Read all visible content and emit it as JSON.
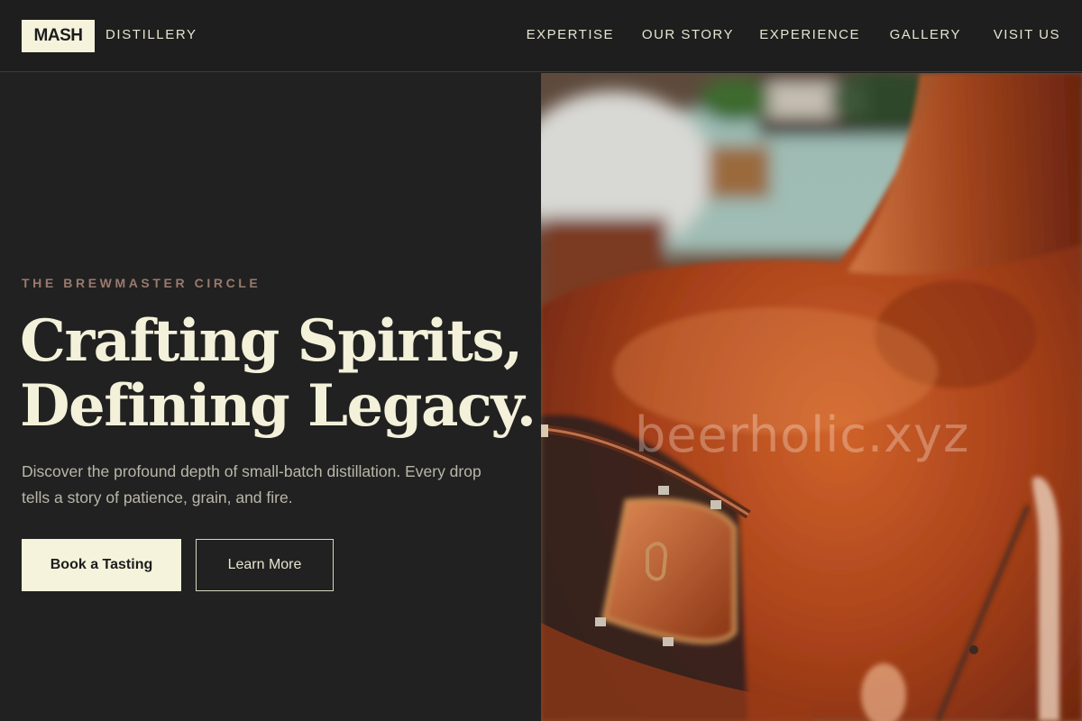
{
  "brand": {
    "logo": "MASH",
    "subtitle": "DISTILLERY"
  },
  "nav": {
    "items": [
      {
        "label": "EXPERTISE"
      },
      {
        "label": "OUR STORY"
      },
      {
        "label": "EXPERIENCE"
      },
      {
        "label": "GALLERY"
      },
      {
        "label": "VISIT US"
      }
    ]
  },
  "hero": {
    "eyebrow": "THE BREWMASTER CIRCLE",
    "headline_line1": "Crafting Spirits,",
    "headline_line2": "Defining Legacy.",
    "description": "Discover the profound depth of small-batch distillation. Every drop tells a story of patience, grain, and fire.",
    "primary_button": "Book a Tasting",
    "secondary_button": "Learn More"
  },
  "image": {
    "watermark": "beerholic.xyz",
    "icon": "copper-still-photo"
  },
  "colors": {
    "background": "#212121",
    "cream": "#f5f3dc",
    "eyebrow": "#9a7a6e",
    "copper": "#b54a1c"
  }
}
